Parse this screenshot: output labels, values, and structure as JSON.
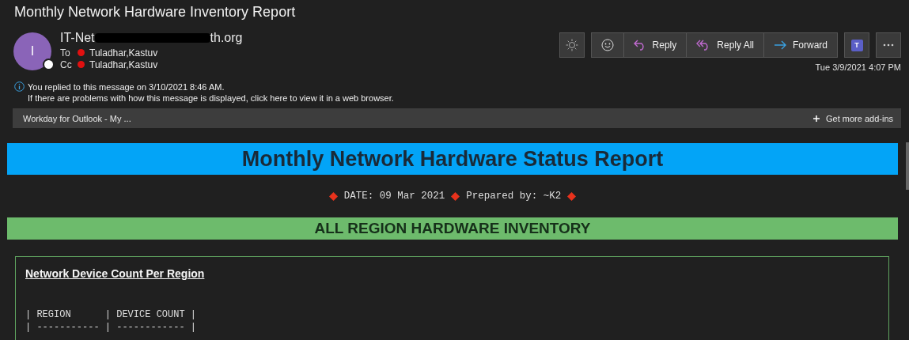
{
  "window": {
    "title": "Monthly Network Hardware Inventory Report"
  },
  "sender": {
    "avatar_initial": "I",
    "address_start": "IT-Net",
    "address_end": "th.org"
  },
  "recipients": [
    {
      "label": "To",
      "name": "Tuladhar,Kastuv"
    },
    {
      "label": "Cc",
      "name": "Tuladhar,Kastuv"
    }
  ],
  "actions": [
    {
      "kind": "reply",
      "label": "Reply"
    },
    {
      "kind": "replyall",
      "label": "Reply All"
    },
    {
      "kind": "forward",
      "label": "Forward"
    }
  ],
  "teams_initial": "T",
  "received": "Tue 3/9/2021 4:07 PM",
  "info": [
    "You replied to this message on 3/10/2021 8:46 AM.",
    "If there are problems with how this message is displayed, click here to view it in a web browser."
  ],
  "addins": {
    "app": "Workday for Outlook - My ...",
    "more": "Get more add-ins"
  },
  "report": {
    "banner": "Monthly Network Hardware Status Report",
    "date": "DATE: 09 Mar 2021",
    "prepared": "Prepared by: ~K2",
    "section": "ALL REGION HARDWARE INVENTORY",
    "card_title": "Network Device Count Per Region",
    "table_lines": [
      "| REGION      | DEVICE COUNT |",
      "| ----------- | ------------ |"
    ]
  }
}
